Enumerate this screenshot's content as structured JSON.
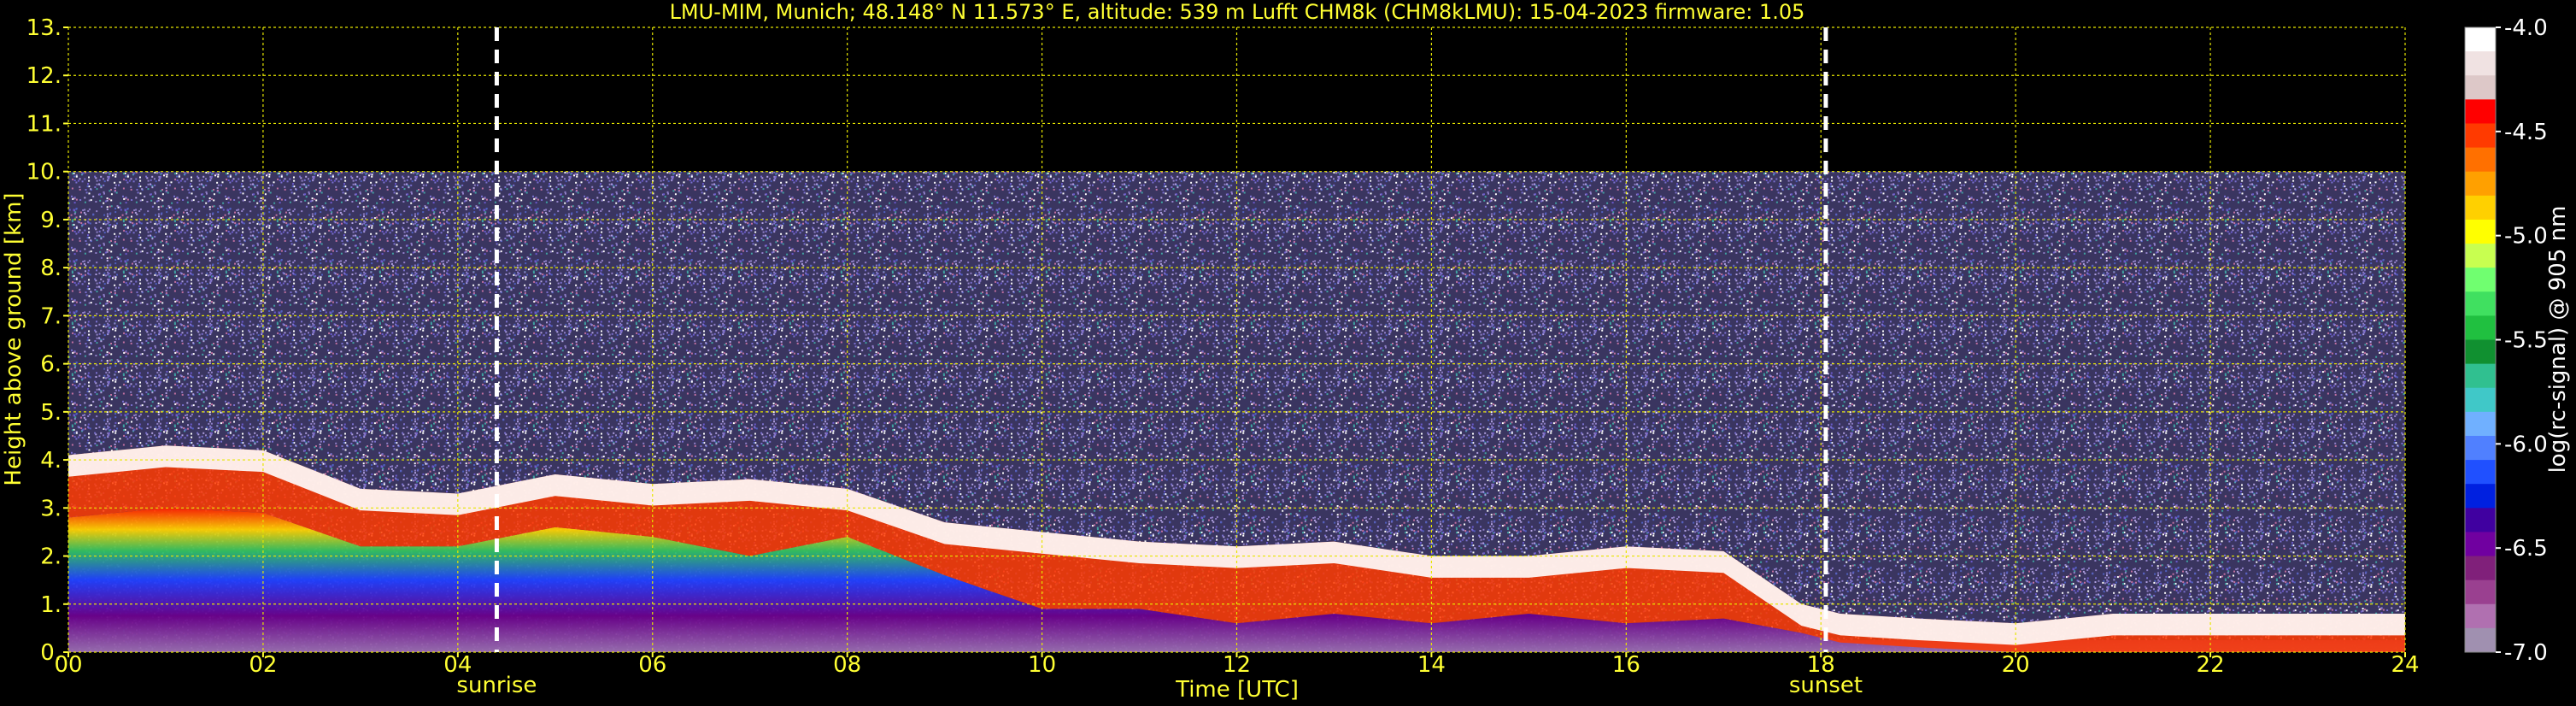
{
  "chart_data": {
    "type": "heatmap",
    "title": "LMU-MIM, Munich; 48.148° N 11.573° E, altitude: 539 m    Lufft CHM8k (CHM8kLMU): 15-04-2023    firmware: 1.05",
    "xlabel": "Time [UTC]",
    "ylabel": "Height above ground [km]",
    "xlim": [
      0,
      24
    ],
    "ylim": [
      0,
      13
    ],
    "x_ticks": [
      "00",
      "02",
      "04",
      "06",
      "08",
      "10",
      "12",
      "14",
      "16",
      "18",
      "20",
      "22",
      "24"
    ],
    "y_ticks": [
      "0.",
      "1.",
      "2.",
      "3.",
      "4.",
      "5.",
      "6.",
      "7.",
      "8.",
      "9.",
      "10.",
      "11.",
      "12.",
      "13."
    ],
    "grid": true,
    "data_height_max_km": 10,
    "events": [
      {
        "label": "sunrise",
        "time_h": 4.4
      },
      {
        "label": "sunset",
        "time_h": 18.05
      }
    ],
    "colorbar": {
      "label": "log(rc-signal) @ 905 nm",
      "range": [
        -7.0,
        -4.0
      ],
      "ticks": [
        "-4.0",
        "-4.5",
        "-5.0",
        "-5.5",
        "-6.0",
        "-6.5",
        "-7.0"
      ],
      "colors": [
        "#ffffff",
        "#f0e2e2",
        "#ddc8c8",
        "#ff0000",
        "#ff3a00",
        "#ff7000",
        "#ffa000",
        "#ffd000",
        "#ffff00",
        "#c8ff50",
        "#70ff70",
        "#40e060",
        "#20c040",
        "#109030",
        "#30c090",
        "#40c8c8",
        "#70b0ff",
        "#5080ff",
        "#2050ff",
        "#0020e0",
        "#4000a0",
        "#7000a0",
        "#80207a",
        "#9a4090",
        "#b070b0",
        "#a090b0"
      ]
    },
    "series": [
      {
        "time_h": [
          0,
          1,
          2,
          3,
          4,
          5,
          6,
          7,
          8,
          9,
          10,
          11,
          12,
          13,
          14,
          15,
          16,
          17,
          17.8,
          18.2,
          19,
          20,
          21,
          22,
          23,
          24
        ],
        "cloud_top_km": [
          4.1,
          4.3,
          4.2,
          3.4,
          3.3,
          3.7,
          3.5,
          3.6,
          3.4,
          2.7,
          2.5,
          2.3,
          2.2,
          2.3,
          2.0,
          2.0,
          2.2,
          2.1,
          1.0,
          0.8,
          0.7,
          0.6,
          0.8,
          0.8,
          0.8,
          0.8
        ],
        "cloud_base_km": [
          2.8,
          3.0,
          2.9,
          2.2,
          2.2,
          2.6,
          2.4,
          2.0,
          2.4,
          1.6,
          0.9,
          0.9,
          0.6,
          0.8,
          0.6,
          0.8,
          0.6,
          0.7,
          0.4,
          0.2,
          0.1,
          0.0,
          0.0,
          0.0,
          0.0,
          0.0
        ]
      }
    ]
  }
}
